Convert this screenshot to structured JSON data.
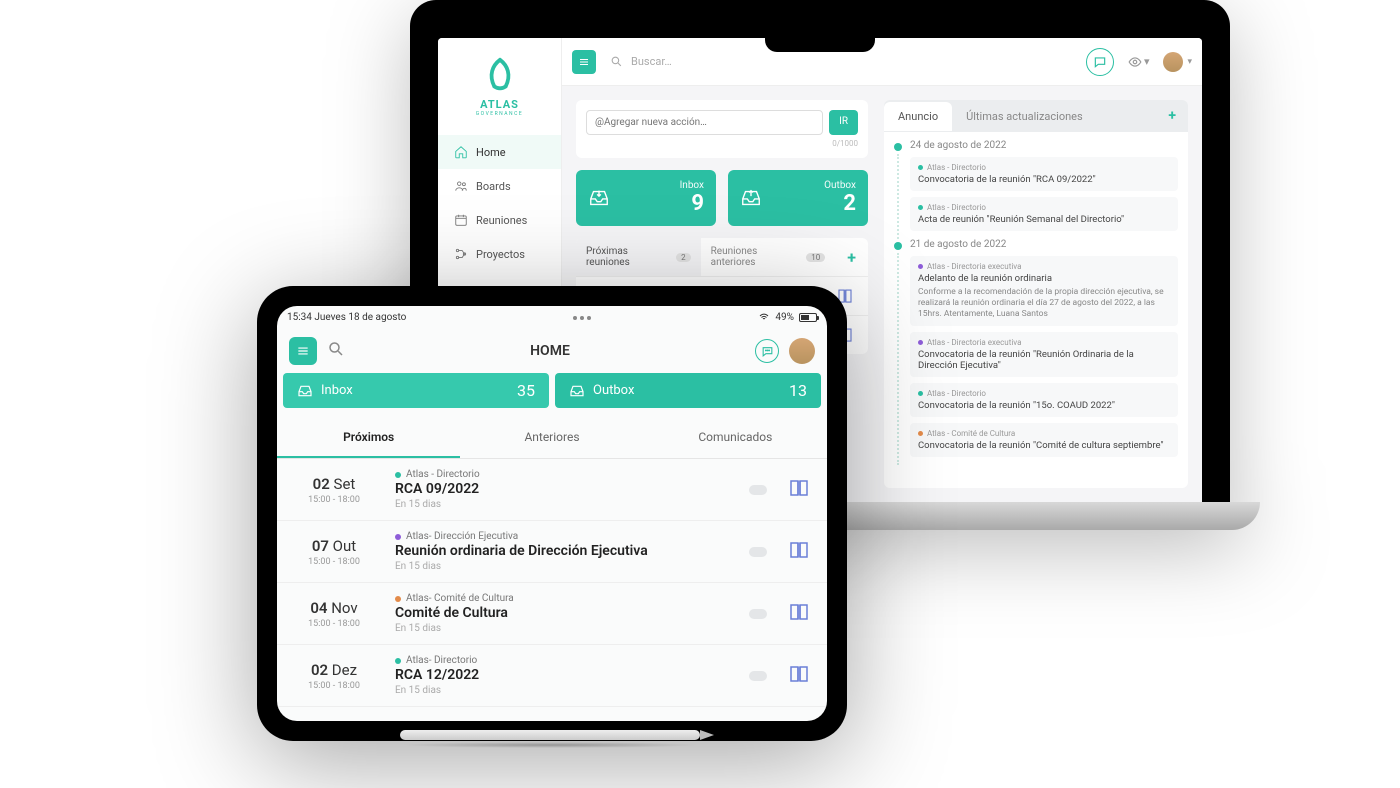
{
  "colors": {
    "accent": "#2bbfa3",
    "purple": "#8e5dd8",
    "orange": "#e38b4a",
    "blue": "#6b7fd7"
  },
  "laptop": {
    "logo": {
      "name": "ATLAS",
      "sub": "GOVERNANCE"
    },
    "nav": [
      {
        "label": "Home",
        "icon": "home"
      },
      {
        "label": "Boards",
        "icon": "users"
      },
      {
        "label": "Reuniones",
        "icon": "calendar"
      },
      {
        "label": "Proyectos",
        "icon": "project"
      }
    ],
    "search_placeholder": "Buscar…",
    "action": {
      "placeholder": "@Agregar nueva acción…",
      "button": "IR",
      "counter": "0/1000"
    },
    "inbox": {
      "label": "Inbox",
      "count": "9"
    },
    "outbox": {
      "label": "Outbox",
      "count": "2"
    },
    "meeting_tabs": {
      "upcoming": {
        "label": "Próximas reuniones",
        "badge": "2"
      },
      "previous": {
        "label": "Reuniones anteriores",
        "badge": "10"
      }
    },
    "ann_tabs": {
      "announce": "Anuncio",
      "updates": "Últimas actualizaciones"
    },
    "feed": [
      {
        "date": "24 de agosto de 2022",
        "items": [
          {
            "src": "Atlas - Directorio",
            "color": "#2bbfa3",
            "title": "Convocatoria de la reunión \"RCA 09/2022\""
          },
          {
            "src": "Atlas - Directorio",
            "color": "#2bbfa3",
            "title": "Acta de reunión \"Reunión Semanal del Directorio\""
          }
        ]
      },
      {
        "date": "21 de agosto de 2022",
        "items": [
          {
            "src": "Atlas - Directoria executiva",
            "color": "#8e5dd8",
            "title": "Adelanto de la reunión ordinaria",
            "desc": "Conforme a la recomendación de la propia dirección ejecutiva, se realizará la reunión ordinaria el día 27 de agosto del 2022, a las 15hrs. Atentamente, Luana Santos"
          },
          {
            "src": "Atlas - Directoria executiva",
            "color": "#8e5dd8",
            "title": "Convocatoria de la reunión \"Reunión Ordinaria de la Dirección Ejecutiva\""
          },
          {
            "src": "Atlas - Directorio",
            "color": "#2bbfa3",
            "title": "Convocatoria de la reunión \"15o. COAUD 2022\""
          },
          {
            "src": "Atlas - Comité de Cultura",
            "color": "#e38b4a",
            "title": "Convocatoria de la reunión \"Comité de cultura septiembre\""
          }
        ]
      }
    ]
  },
  "tablet": {
    "status": {
      "time": "15:34 Jueves 18 de agosto",
      "battery": "49%"
    },
    "title": "HOME",
    "inbox": {
      "label": "Inbox",
      "count": "35"
    },
    "outbox": {
      "label": "Outbox",
      "count": "13"
    },
    "tabs": [
      "Próximos",
      "Anteriores",
      "Comunicados"
    ],
    "rows": [
      {
        "day": "02",
        "mon": "Set",
        "time": "15:00 - 18:00",
        "src": "Atlas - Directorio",
        "color": "#2bbfa3",
        "title": "RCA 09/2022",
        "eta": "En 15 dias"
      },
      {
        "day": "07",
        "mon": "Out",
        "time": "15:00 - 18:00",
        "src": "Atlas- Dirección Ejecutiva",
        "color": "#8e5dd8",
        "title": "Reunión ordinaria de Dirección Ejecutiva",
        "eta": "En 15 dias"
      },
      {
        "day": "04",
        "mon": "Nov",
        "time": "15:00 - 18:00",
        "src": "Atlas- Comité de Cultura",
        "color": "#e38b4a",
        "title": "Comité de Cultura",
        "eta": "En 15 dias"
      },
      {
        "day": "02",
        "mon": "Dez",
        "time": "15:00 - 18:00",
        "src": "Atlas- Directorio",
        "color": "#2bbfa3",
        "title": "RCA 12/2022",
        "eta": "En 15 dias"
      }
    ]
  }
}
